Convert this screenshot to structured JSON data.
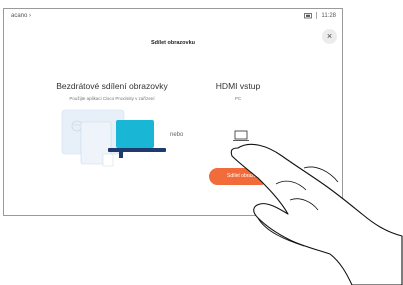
{
  "statusbar": {
    "device_name": "acano",
    "chevron": "›",
    "clock": "11:28",
    "screen_icon": "screen-share-icon"
  },
  "dialog": {
    "title": "Sdílet obrazovku",
    "close_icon": "close-icon",
    "close_glyph": "×"
  },
  "wireless": {
    "title": "Bezdrátové sdílení obrazovky",
    "subtitle": "Použijte aplikaci Cisco Proximity v zařízení"
  },
  "separator_label": "nebo",
  "hdmi": {
    "title": "HDMI vstup",
    "subtitle": "PC"
  },
  "share_button": {
    "label": "Sdílet obrazovku"
  },
  "colors": {
    "accent": "#f26b3a",
    "illustration_teal": "#1ab6d6",
    "illustration_light": "#dcebf7",
    "illustration_navy": "#1f3a6e"
  }
}
